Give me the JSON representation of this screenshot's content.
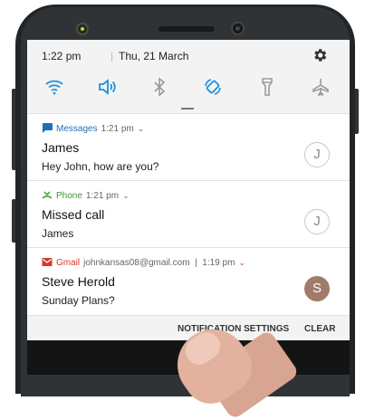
{
  "status": {
    "time": "1:22 pm",
    "separator": "|",
    "date": "Thu, 21 March"
  },
  "quick_settings": [
    {
      "icon": "wifi-icon",
      "active": true
    },
    {
      "icon": "sound-icon",
      "active": true
    },
    {
      "icon": "bluetooth-icon",
      "active": false
    },
    {
      "icon": "auto-rotate-icon",
      "active": true
    },
    {
      "icon": "flashlight-icon",
      "active": false
    },
    {
      "icon": "airplane-mode-icon",
      "active": false
    }
  ],
  "notifications": [
    {
      "app": "Messages",
      "meta": "1:21 pm",
      "title": "James",
      "body": "Hey John, how are you?",
      "avatar": "J",
      "app_color": "#1f6fb8"
    },
    {
      "app": "Phone",
      "meta": "1:21 pm",
      "title": "Missed call",
      "body": "James",
      "avatar": "J",
      "app_color": "#3a9a3a"
    },
    {
      "app": "Gmail",
      "meta": "johnkansas08@gmail.com  |  1:19 pm",
      "title": "Steve Herold",
      "body": "Sunday Plans?",
      "avatar": "S",
      "app_color": "#d23b2c"
    }
  ],
  "actions": {
    "settings": "NOTIFICATION SETTINGS",
    "clear": "CLEAR"
  },
  "colors": {
    "accent": "#1f8fe0",
    "inactive_icon": "#9a9a9a"
  }
}
